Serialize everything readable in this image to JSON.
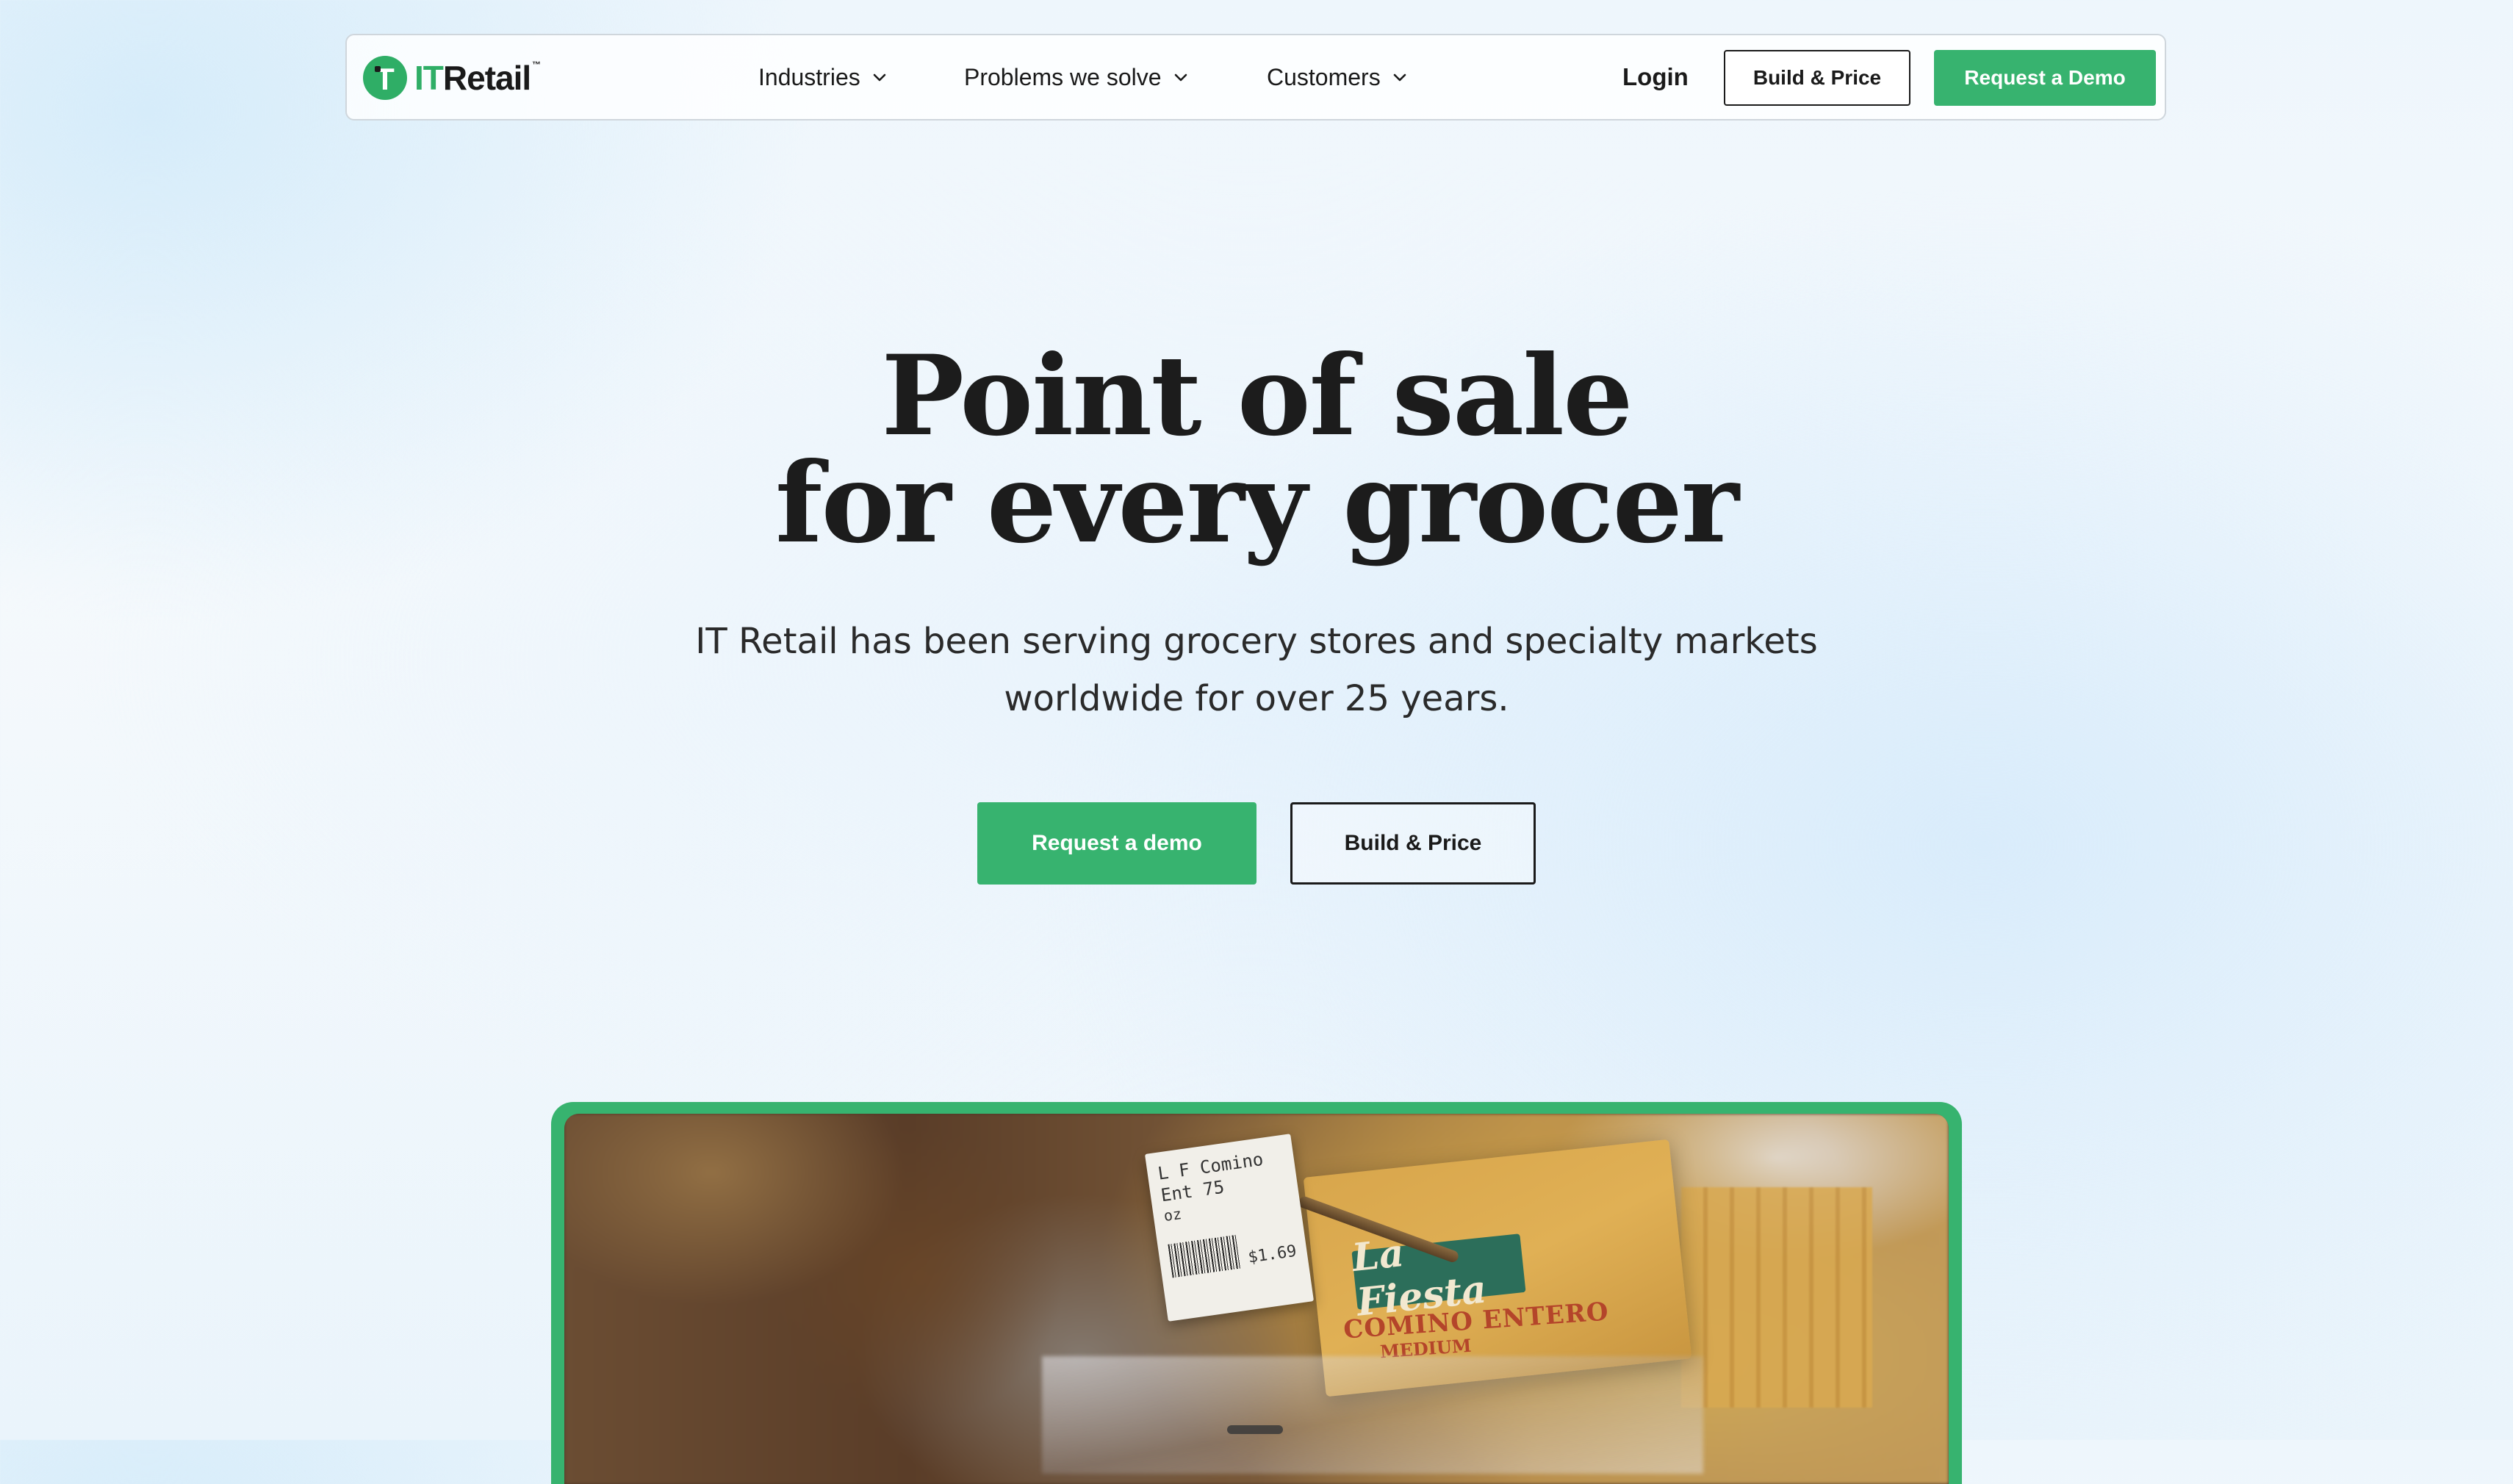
{
  "brand": {
    "logo_mark": "T",
    "logo_prefix": "IT",
    "logo_suffix": "Retail",
    "logo_tm": "™",
    "accent_color": "#37b36f",
    "text_color": "#1a1a1a"
  },
  "nav": {
    "menu": [
      {
        "label": "Industries",
        "icon": "chevron-down-icon"
      },
      {
        "label": "Problems we solve",
        "icon": "chevron-down-icon"
      },
      {
        "label": "Customers",
        "icon": "chevron-down-icon"
      }
    ],
    "login_label": "Login",
    "build_price_label": "Build & Price",
    "request_demo_label": "Request a Demo"
  },
  "hero": {
    "title_line1": "Point of sale",
    "title_line2": "for every grocer",
    "subtitle_line1": "IT Retail has been serving grocery stores and specialty markets",
    "subtitle_line2": "worldwide for over 25 years.",
    "cta_primary_label": "Request a demo",
    "cta_secondary_label": "Build & Price"
  },
  "media": {
    "price_tag_name": "L F Comino Ent 75",
    "price_tag_unit": "oz",
    "price_tag_price": "$1.69",
    "package_brand": "La Fiesta",
    "package_text": "COMINO ENTERO",
    "package_subtext": "MEDIUM"
  }
}
